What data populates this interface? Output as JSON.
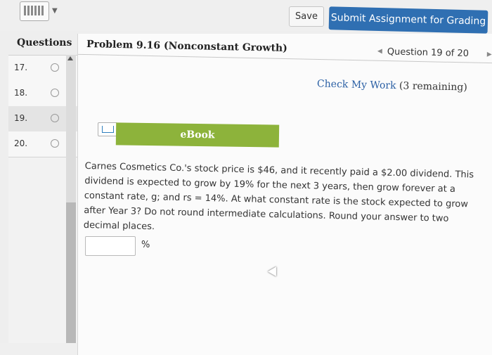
{
  "toolbar": {
    "keyboard_icon": "keyboard-icon",
    "save_label": "Save",
    "submit_label": "Submit Assignment for Grading"
  },
  "sidebar": {
    "header": "Questions",
    "items": [
      {
        "number": "17.",
        "status": "unanswered"
      },
      {
        "number": "18.",
        "status": "unanswered"
      },
      {
        "number": "19.",
        "status": "unanswered",
        "active": true
      },
      {
        "number": "20.",
        "status": "unanswered"
      }
    ]
  },
  "problem": {
    "title": "Problem 9.16 (Nonconstant Growth)",
    "question_nav": "Question 19 of 20",
    "check_label": "Check My Work",
    "remaining": "(3 remaining)",
    "ebook_label": "eBook",
    "text": "Carnes Cosmetics Co.'s stock price is $46, and it recently paid a $2.00 dividend. This dividend is expected to grow by 19% for the next 3 years, then grow forever at a constant rate, g; and rs = 14%. At what constant rate is the stock expected to grow after Year 3? Do not round intermediate calculations. Round your answer to two decimal places.",
    "answer_value": "",
    "unit": "%"
  },
  "colors": {
    "submit_bg": "#2f6fb2",
    "ebook_bg": "#8db33b",
    "link": "#2a5fa4"
  }
}
